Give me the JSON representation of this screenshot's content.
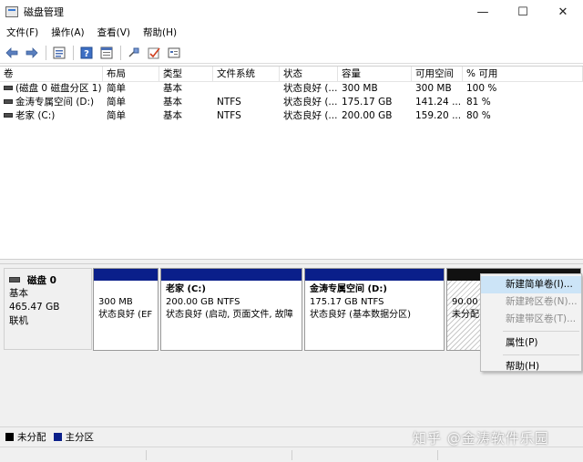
{
  "window": {
    "title": "磁盘管理",
    "controls": {
      "minimize": "—",
      "maximize": "☐",
      "close": "✕"
    }
  },
  "menu": [
    "文件(F)",
    "操作(A)",
    "查看(V)",
    "帮助(H)"
  ],
  "toolbar": {
    "icons": [
      "back-arrow-icon",
      "forward-arrow-icon",
      "list-view-icon",
      "help-icon",
      "properties-icon",
      "connect-icon",
      "check-icon",
      "console-icon"
    ]
  },
  "volume_table": {
    "columns": [
      "卷",
      "布局",
      "类型",
      "文件系统",
      "状态",
      "容量",
      "可用空间",
      "% 可用"
    ],
    "rows": [
      [
        "(磁盘 0 磁盘分区 1)",
        "简单",
        "基本",
        "",
        "状态良好 (...",
        "300 MB",
        "300 MB",
        "100 %"
      ],
      [
        "金涛专属空间 (D:)",
        "简单",
        "基本",
        "NTFS",
        "状态良好 (...",
        "175.17 GB",
        "141.24 ...",
        "81 %"
      ],
      [
        "老家 (C:)",
        "简单",
        "基本",
        "NTFS",
        "状态良好 (...",
        "200.00 GB",
        "159.20 ...",
        "80 %"
      ]
    ]
  },
  "disk": {
    "name": "磁盘 0",
    "type": "基本",
    "size": "465.47 GB",
    "status": "联机",
    "partitions": [
      {
        "name": "",
        "size_fs": "300 MB",
        "status": "状态良好 (EF"
      },
      {
        "name": "老家  (C:)",
        "size_fs": "200.00 GB NTFS",
        "status": "状态良好 (启动, 页面文件, 故障"
      },
      {
        "name": "金涛专属空间  (D:)",
        "size_fs": "175.17 GB NTFS",
        "status": "状态良好 (基本数据分区)"
      },
      {
        "name": "",
        "size_fs": "90.00 G",
        "status": "未分配"
      }
    ]
  },
  "context_menu": {
    "items": [
      {
        "label": "新建简单卷(I)...",
        "enabled": true,
        "highlighted": true
      },
      {
        "label": "新建跨区卷(N)...",
        "enabled": false
      },
      {
        "label": "新建带区卷(T)...",
        "enabled": false
      },
      {
        "label": "属性(P)",
        "enabled": true
      },
      {
        "label": "帮助(H)",
        "enabled": true
      }
    ]
  },
  "legend": [
    {
      "label": "未分配",
      "color": "#000000"
    },
    {
      "label": "主分区",
      "color": "#0a1f8a"
    }
  ],
  "watermark": "知乎 @金涛软件乐园"
}
